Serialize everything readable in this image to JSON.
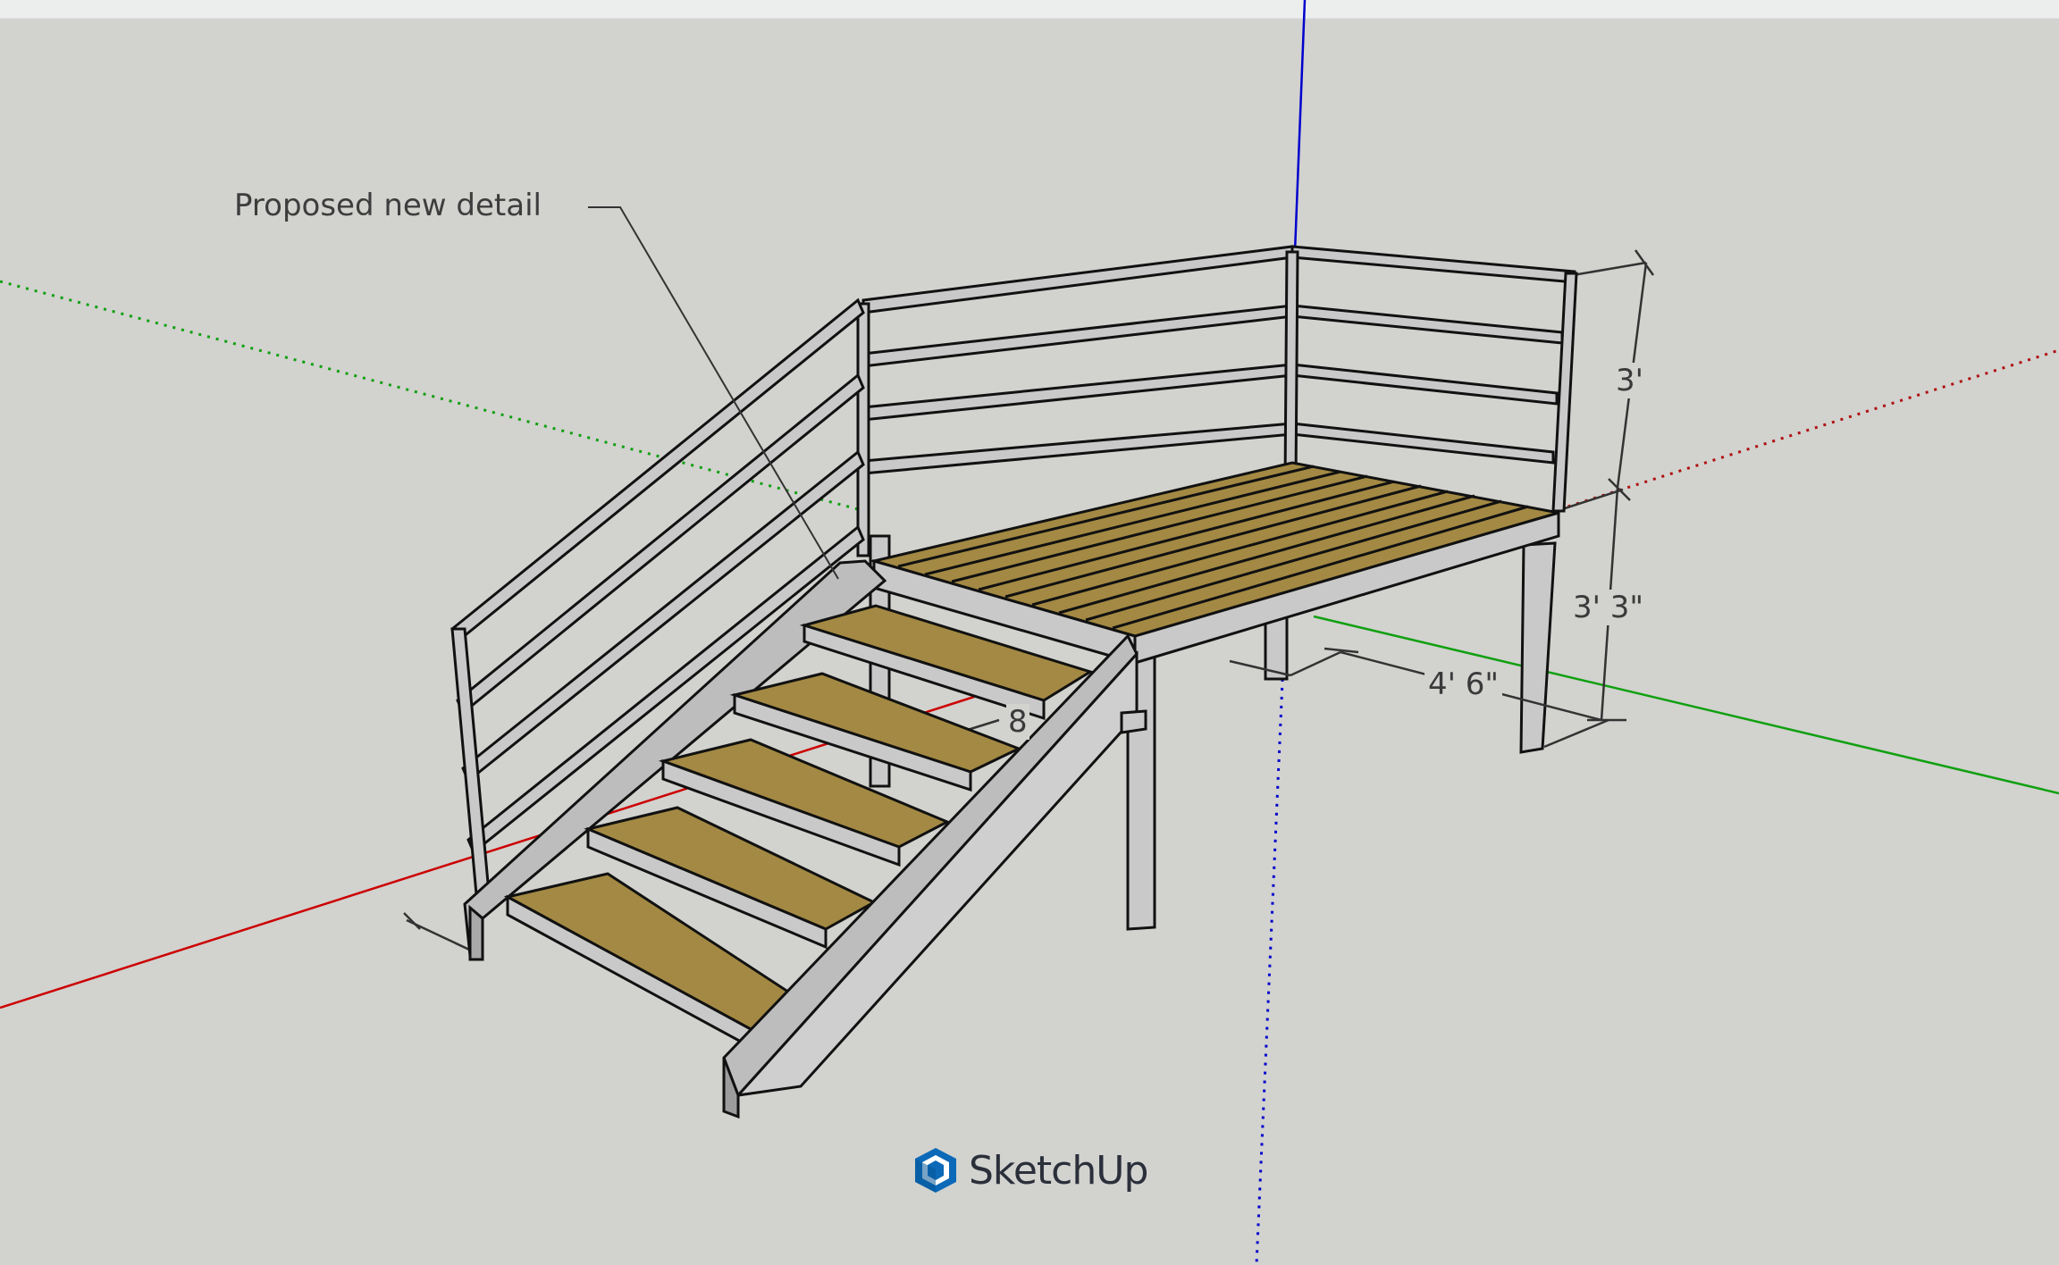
{
  "annotation": {
    "text": "Proposed new detail"
  },
  "dimensions": {
    "rail_height": "3'",
    "platform_height": "3' 3\"",
    "platform_depth": "4' 6\"",
    "partial_hidden": "8"
  },
  "watermark": {
    "brand": "SketchUp",
    "icon": "sketchup-logo-icon"
  },
  "colors": {
    "background": "#d2d2cf",
    "wood": "#a38943",
    "steel": "#c9c9c9",
    "x_axis": "#cc0000",
    "y_axis": "#009900",
    "z_axis": "#0000cc",
    "brand": "#0b69b8"
  }
}
